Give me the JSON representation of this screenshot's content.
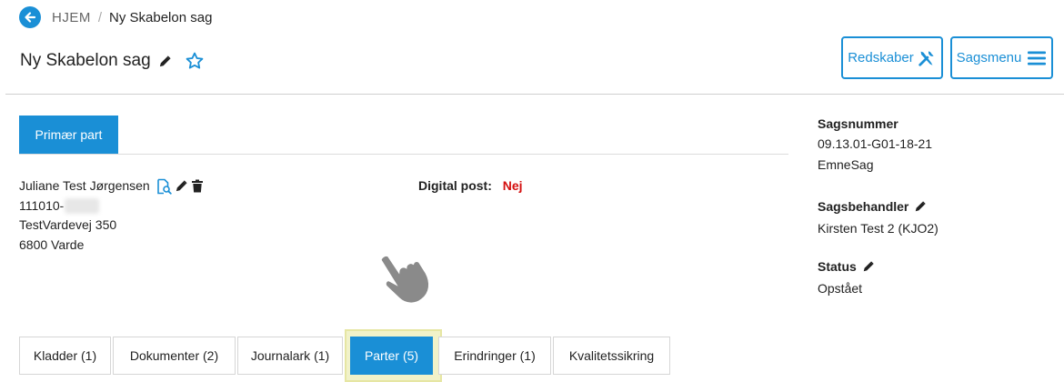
{
  "breadcrumb": {
    "home": "HJEM",
    "separator": "/",
    "current": "Ny Skabelon sag"
  },
  "header": {
    "title": "Ny Skabelon sag"
  },
  "toolbar": {
    "tools_label": "Redskaber",
    "menu_label": "Sagsmenu"
  },
  "party_tabs": {
    "primary": "Primær part"
  },
  "party": {
    "name": "Juliane Test Jørgensen",
    "cpr_prefix": "111010-",
    "address": "TestVardevej 350",
    "city": "6800 Varde"
  },
  "digital_post": {
    "label": "Digital post:",
    "value": "Nej"
  },
  "case_info": {
    "number_label": "Sagsnummer",
    "number": "09.13.01-G01-18-21",
    "type": "EmneSag",
    "handler_label": "Sagsbehandler",
    "handler": "Kirsten Test 2 (KJO2)",
    "status_label": "Status",
    "status": "Opstået"
  },
  "tabs": [
    {
      "label": "Kladder (1)"
    },
    {
      "label": "Dokumenter (2)"
    },
    {
      "label": "Journalark (1)"
    },
    {
      "label": "Parter (5)",
      "active": true
    },
    {
      "label": "Erindringer (1)"
    },
    {
      "label": "Kvalitetssikring"
    }
  ],
  "colors": {
    "accent": "#1a8fd6",
    "negative": "#d40f0f",
    "highlight": "#f1f2c9"
  },
  "icons": [
    "back-arrow-icon",
    "pencil-icon",
    "star-icon",
    "tools-icon",
    "hamburger-icon",
    "search-document-icon",
    "trash-icon",
    "pointing-hand-icon"
  ]
}
